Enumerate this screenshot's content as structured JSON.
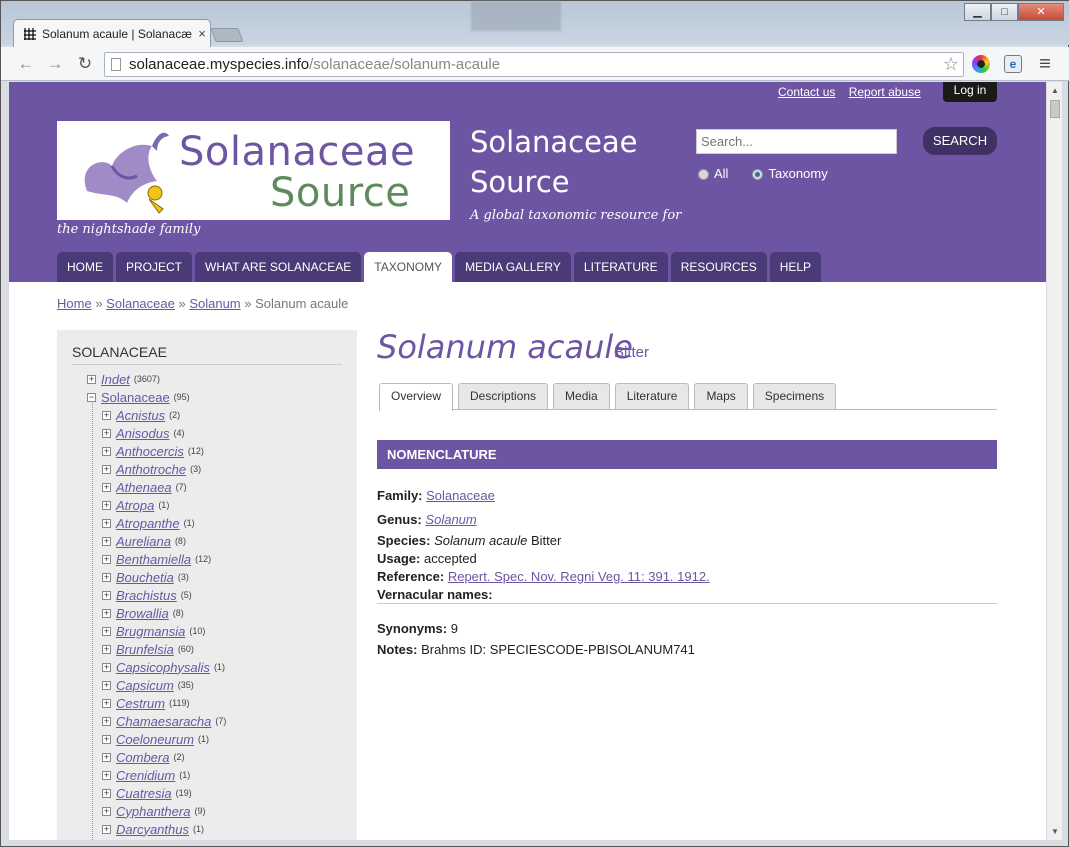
{
  "browser": {
    "tab_title": "Solanum acaule | Solanacæ",
    "url_host": "solanaceae.myspecies.info",
    "url_path": "/solanaceae/solanum-acaule",
    "close_glyph": "×",
    "back_glyph": "←",
    "forward_glyph": "→",
    "reload_glyph": "↻",
    "star_glyph": "☆",
    "menu_glyph": "≡",
    "minimize_glyph": "▁",
    "maximize_glyph": "□",
    "window_close_glyph": "✕"
  },
  "header": {
    "contact_link": "Contact us",
    "report_link": "Report abuse",
    "login_label": "Log in",
    "logo_line1": "Solanaceae",
    "logo_line2": "Source",
    "logo_tagline": "the nightshade family",
    "site_name_line1": "Solanaceae",
    "site_name_line2": "Source",
    "site_slogan": "A global taxonomic resource for",
    "search_placeholder": "Search...",
    "search_button": "SEARCH",
    "radio_all": "All",
    "radio_taxonomy": "Taxonomy",
    "brand_color": "#6d55a4"
  },
  "nav": [
    {
      "label": "HOME"
    },
    {
      "label": "PROJECT"
    },
    {
      "label": "WHAT ARE SOLANACEAE"
    },
    {
      "label": "TAXONOMY"
    },
    {
      "label": "MEDIA GALLERY"
    },
    {
      "label": "LITERATURE"
    },
    {
      "label": "RESOURCES"
    },
    {
      "label": "HELP"
    }
  ],
  "breadcrumb": {
    "home": "Home",
    "sep": "»",
    "family": "Solanaceae",
    "genus": "Solanum",
    "current": "Solanum acaule"
  },
  "sidebar": {
    "title": "SOLANACEAE",
    "plus_glyph": "+",
    "minus_glyph": "−",
    "root": [
      {
        "label": "Indet",
        "count": "(3607)"
      },
      {
        "label": "Solanaceae",
        "count": "(95)"
      }
    ],
    "children": [
      {
        "label": "Acnistus",
        "count": "(2)"
      },
      {
        "label": "Anisodus",
        "count": "(4)"
      },
      {
        "label": "Anthocercis",
        "count": "(12)"
      },
      {
        "label": "Anthotroche",
        "count": "(3)"
      },
      {
        "label": "Athenaea",
        "count": "(7)"
      },
      {
        "label": "Atropa",
        "count": "(1)"
      },
      {
        "label": "Atropanthe",
        "count": "(1)"
      },
      {
        "label": "Aureliana",
        "count": "(8)"
      },
      {
        "label": "Benthamiella",
        "count": "(12)"
      },
      {
        "label": "Bouchetia",
        "count": "(3)"
      },
      {
        "label": "Brachistus",
        "count": "(5)"
      },
      {
        "label": "Browallia",
        "count": "(8)"
      },
      {
        "label": "Brugmansia",
        "count": "(10)"
      },
      {
        "label": "Brunfelsia",
        "count": "(60)"
      },
      {
        "label": "Capsicophysalis",
        "count": "(1)"
      },
      {
        "label": "Capsicum",
        "count": "(35)"
      },
      {
        "label": "Cestrum",
        "count": "(119)"
      },
      {
        "label": "Chamaesaracha",
        "count": "(7)"
      },
      {
        "label": "Coeloneurum",
        "count": "(1)"
      },
      {
        "label": "Combera",
        "count": "(2)"
      },
      {
        "label": "Crenidium",
        "count": "(1)"
      },
      {
        "label": "Cuatresia",
        "count": "(19)"
      },
      {
        "label": "Cyphanthera",
        "count": "(9)"
      },
      {
        "label": "Darcyanthus",
        "count": "(1)"
      }
    ]
  },
  "species": {
    "name": "Solanum acaule",
    "author": "Bitter"
  },
  "tabs": [
    {
      "label": "Overview"
    },
    {
      "label": "Descriptions"
    },
    {
      "label": "Media"
    },
    {
      "label": "Literature"
    },
    {
      "label": "Maps"
    },
    {
      "label": "Specimens"
    }
  ],
  "nomenclature": {
    "heading": "NOMENCLATURE",
    "family_label": "Family:",
    "family_value": "Solanaceae",
    "genus_label": "Genus:",
    "genus_value": "Solanum",
    "species_label": "Species:",
    "species_value_italic": "Solanum acaule",
    "species_value_author": "Bitter",
    "usage_label": "Usage:",
    "usage_value": "accepted",
    "reference_label": "Reference:",
    "reference_value": "Repert. Spec. Nov. Regni Veg. 11: 391. 1912.",
    "vernacular_label": "Vernacular names:",
    "synonyms_label": "Synonyms:",
    "synonyms_value": "9",
    "notes_label": "Notes:",
    "notes_value": "Brahms ID: SPECIESCODE-PBISOLANUM741"
  }
}
